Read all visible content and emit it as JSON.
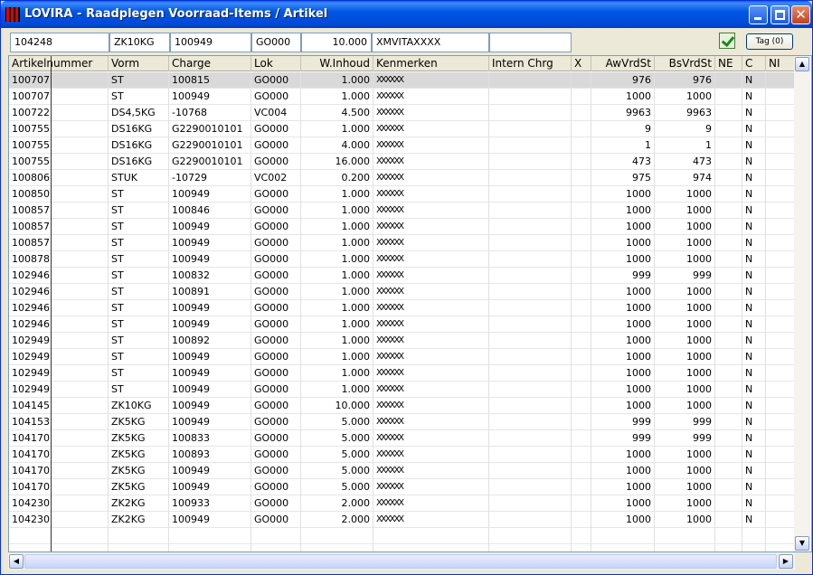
{
  "window": {
    "title": "LOVIRA - Raadplegen Voorraad-Items / Artikel"
  },
  "header": {
    "fields": [
      "104248",
      "ZK10KG",
      "100949",
      "GO000",
      "10.000",
      "XMVITAXXXX",
      ""
    ],
    "tag_label": "Tag (0)"
  },
  "columns": [
    "Artikelnummer",
    "Vorm",
    "Charge",
    "Lok",
    "W.Inhoud",
    "Kenmerken",
    "Intern Chrg",
    "X",
    "AwVrdSt",
    "BsVrdSt",
    "NE",
    "C",
    "NI"
  ],
  "rows": [
    [
      "100707",
      "ST",
      "100815",
      "GO000",
      "1.000",
      "XXXXXX",
      "",
      "",
      "976",
      "976",
      "",
      "N",
      ""
    ],
    [
      "100707",
      "ST",
      "100949",
      "GO000",
      "1.000",
      "XXXXXX",
      "",
      "",
      "1000",
      "1000",
      "",
      "N",
      ""
    ],
    [
      "100722",
      "DS4,5KG",
      "-10768",
      "VC004",
      "4.500",
      "XXXXXX",
      "",
      "",
      "9963",
      "9963",
      "",
      "N",
      ""
    ],
    [
      "100755",
      "DS16KG",
      "G2290010101",
      "GO000",
      "1.000",
      "XXXXXX",
      "",
      "",
      "9",
      "9",
      "",
      "N",
      ""
    ],
    [
      "100755",
      "DS16KG",
      "G2290010101",
      "GO000",
      "4.000",
      "XXXXXX",
      "",
      "",
      "1",
      "1",
      "",
      "N",
      ""
    ],
    [
      "100755",
      "DS16KG",
      "G2290010101",
      "GO000",
      "16.000",
      "XXXXXX",
      "",
      "",
      "473",
      "473",
      "",
      "N",
      ""
    ],
    [
      "100806",
      "STUK",
      "-10729",
      "VC002",
      "0.200",
      "XXXXXX",
      "",
      "",
      "975",
      "974",
      "",
      "N",
      ""
    ],
    [
      "100850",
      "ST",
      "100949",
      "GO000",
      "1.000",
      "XXXXXX",
      "",
      "",
      "1000",
      "1000",
      "",
      "N",
      ""
    ],
    [
      "100857",
      "ST",
      "100846",
      "GO000",
      "1.000",
      "XXXXXX",
      "",
      "",
      "1000",
      "1000",
      "",
      "N",
      ""
    ],
    [
      "100857",
      "ST",
      "100949",
      "GO000",
      "1.000",
      "XXXXXX",
      "",
      "",
      "1000",
      "1000",
      "",
      "N",
      ""
    ],
    [
      "100857",
      "ST",
      "100949",
      "GO000",
      "1.000",
      "XXXXXX",
      "",
      "",
      "1000",
      "1000",
      "",
      "N",
      ""
    ],
    [
      "100878",
      "ST",
      "100949",
      "GO000",
      "1.000",
      "XXXXXX",
      "",
      "",
      "1000",
      "1000",
      "",
      "N",
      ""
    ],
    [
      "102946",
      "ST",
      "100832",
      "GO000",
      "1.000",
      "XXXXXX",
      "",
      "",
      "999",
      "999",
      "",
      "N",
      ""
    ],
    [
      "102946",
      "ST",
      "100891",
      "GO000",
      "1.000",
      "XXXXXX",
      "",
      "",
      "1000",
      "1000",
      "",
      "N",
      ""
    ],
    [
      "102946",
      "ST",
      "100949",
      "GO000",
      "1.000",
      "XXXXXX",
      "",
      "",
      "1000",
      "1000",
      "",
      "N",
      ""
    ],
    [
      "102946",
      "ST",
      "100949",
      "GO000",
      "1.000",
      "XXXXXX",
      "",
      "",
      "1000",
      "1000",
      "",
      "N",
      ""
    ],
    [
      "102949",
      "ST",
      "100892",
      "GO000",
      "1.000",
      "XXXXXX",
      "",
      "",
      "1000",
      "1000",
      "",
      "N",
      ""
    ],
    [
      "102949",
      "ST",
      "100949",
      "GO000",
      "1.000",
      "XXXXXX",
      "",
      "",
      "1000",
      "1000",
      "",
      "N",
      ""
    ],
    [
      "102949",
      "ST",
      "100949",
      "GO000",
      "1.000",
      "XXXXXX",
      "",
      "",
      "1000",
      "1000",
      "",
      "N",
      ""
    ],
    [
      "102949",
      "ST",
      "100949",
      "GO000",
      "1.000",
      "XXXXXX",
      "",
      "",
      "1000",
      "1000",
      "",
      "N",
      ""
    ],
    [
      "104145",
      "ZK10KG",
      "100949",
      "GO000",
      "10.000",
      "XXXXXX",
      "",
      "",
      "1000",
      "1000",
      "",
      "N",
      ""
    ],
    [
      "104153",
      "ZK5KG",
      "100949",
      "GO000",
      "5.000",
      "XXXXXX",
      "",
      "",
      "999",
      "999",
      "",
      "N",
      ""
    ],
    [
      "104170",
      "ZK5KG",
      "100833",
      "GO000",
      "5.000",
      "XXXXXX",
      "",
      "",
      "999",
      "999",
      "",
      "N",
      ""
    ],
    [
      "104170",
      "ZK5KG",
      "100893",
      "GO000",
      "5.000",
      "XXXXXX",
      "",
      "",
      "1000",
      "1000",
      "",
      "N",
      ""
    ],
    [
      "104170",
      "ZK5KG",
      "100949",
      "GO000",
      "5.000",
      "XXXXXX",
      "",
      "",
      "1000",
      "1000",
      "",
      "N",
      ""
    ],
    [
      "104170",
      "ZK5KG",
      "100949",
      "GO000",
      "5.000",
      "XXXXXX",
      "",
      "",
      "1000",
      "1000",
      "",
      "N",
      ""
    ],
    [
      "104230",
      "ZK2KG",
      "100933",
      "GO000",
      "2.000",
      "XXXXXX",
      "",
      "",
      "1000",
      "1000",
      "",
      "N",
      ""
    ],
    [
      "104230",
      "ZK2KG",
      "100949",
      "GO000",
      "2.000",
      "XXXXXX",
      "",
      "",
      "1000",
      "1000",
      "",
      "N",
      ""
    ],
    [
      "",
      "",
      "",
      "",
      "",
      "",
      "",
      "",
      "",
      "",
      "",
      "",
      ""
    ],
    [
      "",
      "",
      "",
      "",
      "",
      "",
      "",
      "",
      "",
      "",
      "",
      "",
      ""
    ]
  ],
  "selected_row": 0,
  "scrollbar": {
    "up_glyph": "▲",
    "down_glyph": "▼",
    "left_glyph": "◀",
    "right_glyph": "▶"
  }
}
